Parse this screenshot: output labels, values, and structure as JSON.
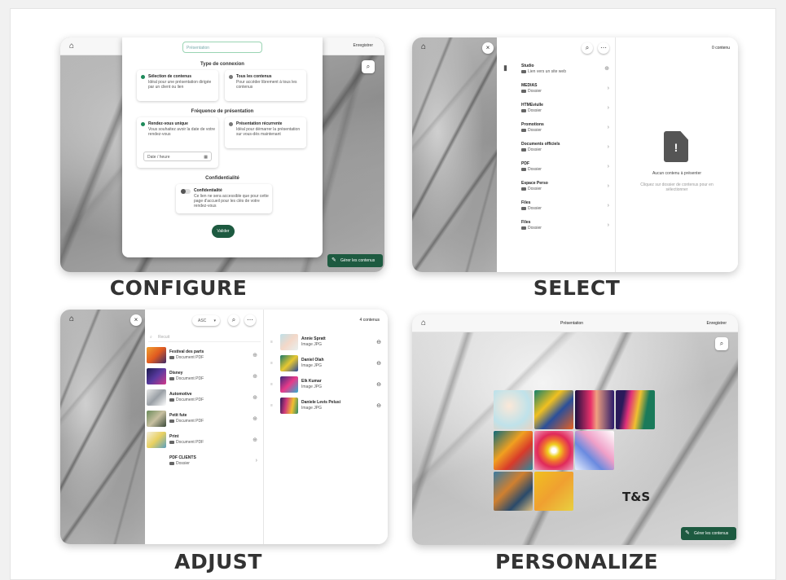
{
  "captions": {
    "configure": "CONFIGURE",
    "select": "SELECT",
    "adjust": "ADJUST",
    "personalize": "PERSONALIZE"
  },
  "configure": {
    "input_placeholder": "Présentation",
    "type_title": "Type de connexion",
    "opt1_title": "Sélection de contenus",
    "opt1_desc": "Idéal pour une présentation dirigée par un client ou lien",
    "opt2_title": "Tous les contenus",
    "opt2_desc": "Pour accéder librement à tous les contenus",
    "freq_title": "Fréquence de présentation",
    "opt3_title": "Rendez-vous unique",
    "opt3_desc": "Vous souhaitez avoir la date de votre rendez-vous",
    "opt4_title": "Présentation récurrente",
    "opt4_desc": "Idéal pour démarrer la présentation sur vous-dès maintenant",
    "date_label": "Date / heure",
    "conf_title": "Confidentialité",
    "conf_toggle_title": "Confidentialité",
    "conf_toggle_desc": "Ce lien ne sera accessible que pour cette page d'accueil pour les clés de votre rendez-vous",
    "submit": "Valider",
    "top_right": "Enregistrer",
    "bottom_button": "Gérer les contenus"
  },
  "select": {
    "count": "0 contenu",
    "items": [
      {
        "title": "Studio",
        "sub": "Lien vers un site web"
      },
      {
        "title": "MEDIAS",
        "sub": "Dossier"
      },
      {
        "title": "HTMEviulle",
        "sub": "Dossier"
      },
      {
        "title": "Promotions",
        "sub": "Dossier"
      },
      {
        "title": "Documents officiels",
        "sub": "Dossier"
      },
      {
        "title": "PDF",
        "sub": "Dossier"
      },
      {
        "title": "Espace Perso",
        "sub": "Dossier"
      },
      {
        "title": "Files",
        "sub": "Dossier"
      },
      {
        "title": "Files",
        "sub": "Dossier"
      }
    ],
    "empty_title": "Aucun contenu à présenter",
    "empty_desc": "Cliquez sur dossier de contenus pour en sélectionner"
  },
  "adjust": {
    "sort_label": "ASC",
    "search_placeholder": "Recuit",
    "count": "4 contenus",
    "left_items": [
      {
        "title": "Festival des parts",
        "sub": "Document PDF"
      },
      {
        "title": "Disney",
        "sub": "Document PDF"
      },
      {
        "title": "Automotive",
        "sub": "Document PDF"
      },
      {
        "title": "Petit fute",
        "sub": "Document PDF"
      },
      {
        "title": "Print",
        "sub": "Document PDF"
      },
      {
        "title": "PDF CLIENTS",
        "sub": "Dossier"
      }
    ],
    "right_items": [
      {
        "title": "Annie Spratt",
        "sub": "Image JPG"
      },
      {
        "title": "Daniel Olah",
        "sub": "Image JPG"
      },
      {
        "title": "Elk Kumar",
        "sub": "Image JPG"
      },
      {
        "title": "Daniele Levis Pelusi",
        "sub": "Image JPG"
      }
    ]
  },
  "personalize": {
    "center_label": "Présentation",
    "top_right": "Enregistrer",
    "logo_text": "T&S",
    "bottom_button": "Gérer les contenus"
  }
}
